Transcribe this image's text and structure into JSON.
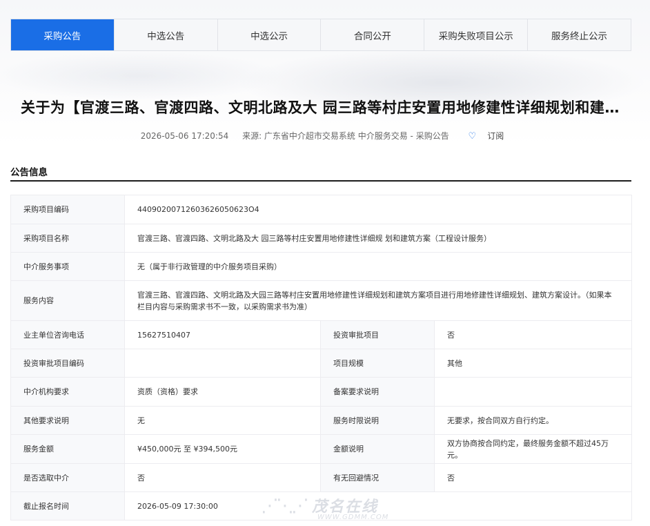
{
  "tabs": [
    {
      "label": "采购公告",
      "active": true
    },
    {
      "label": "中选公告",
      "active": false
    },
    {
      "label": "中选公示",
      "active": false
    },
    {
      "label": "合同公开",
      "active": false
    },
    {
      "label": "采购失败项目公示",
      "active": false
    },
    {
      "label": "服务终止公示",
      "active": false
    }
  ],
  "page_title": "关于为【官渡三路、官渡四路、文明北路及大 园三路等村庄安置用地修建性详细规划和建筑方案(工程设计服务)】项目采购公告",
  "meta": {
    "datetime": "2026-05-06 17:20:54",
    "source": "来源: 广东省中介超市交易系统 中介服务交易 - 采购公告",
    "subscribe_label": "订阅"
  },
  "section": {
    "title": "公告信息"
  },
  "rows": {
    "project_code": {
      "label": "采购项目编码",
      "value": "44090200712603626050623O4"
    },
    "project_name": {
      "label": "采购项目名称",
      "value": "官渡三路、官渡四路、文明北路及大 园三路等村庄安置用地修建性详细规 划和建筑方案（工程设计服务）"
    },
    "service_item": {
      "label": "中介服务事项",
      "value": "无（属于非行政管理的中介服务项目采购）"
    },
    "service_content": {
      "label": "服务内容",
      "value": "官渡三路、官渡四路、文明北路及大园三路等村庄安置用地修建性详细规划和建筑方案项目进行用地修建性详细规划、建筑方案设计。（如果本栏目内容与采购需求书不一致，以采购需求书为准）"
    },
    "phone": {
      "label": "业主单位咨询电话",
      "value": "15627510407"
    },
    "invest_approval": {
      "label": "投资审批项目",
      "value": "否"
    },
    "invest_code": {
      "label": "投资审批项目编码",
      "value": ""
    },
    "project_scale": {
      "label": "项目规模",
      "value": "其他"
    },
    "agency_req": {
      "label": "中介机构要求",
      "value": "资质（资格）要求"
    },
    "filing_req": {
      "label": "备案要求说明",
      "value": ""
    },
    "other_req": {
      "label": "其他要求说明",
      "value": "无"
    },
    "time_limit": {
      "label": "服务时限说明",
      "value": "无要求，按合同双方自行约定。"
    },
    "amount": {
      "label": "服务金额",
      "value": "¥450,000元 至 ¥394,500元"
    },
    "amount_note": {
      "label": "金额说明",
      "value": "双方协商按合同约定，最终服务金额不超过45万元。"
    },
    "random_select": {
      "label": "是否选取中介",
      "value": "否"
    },
    "avoidance": {
      "label": "有无回避情况",
      "value": "否"
    },
    "deadline": {
      "label": "截止报名时间",
      "value": "2026-05-09 17:30:00"
    }
  },
  "watermark": {
    "brand": "茂名在线",
    "url": "WWW.GDMM.COM"
  }
}
